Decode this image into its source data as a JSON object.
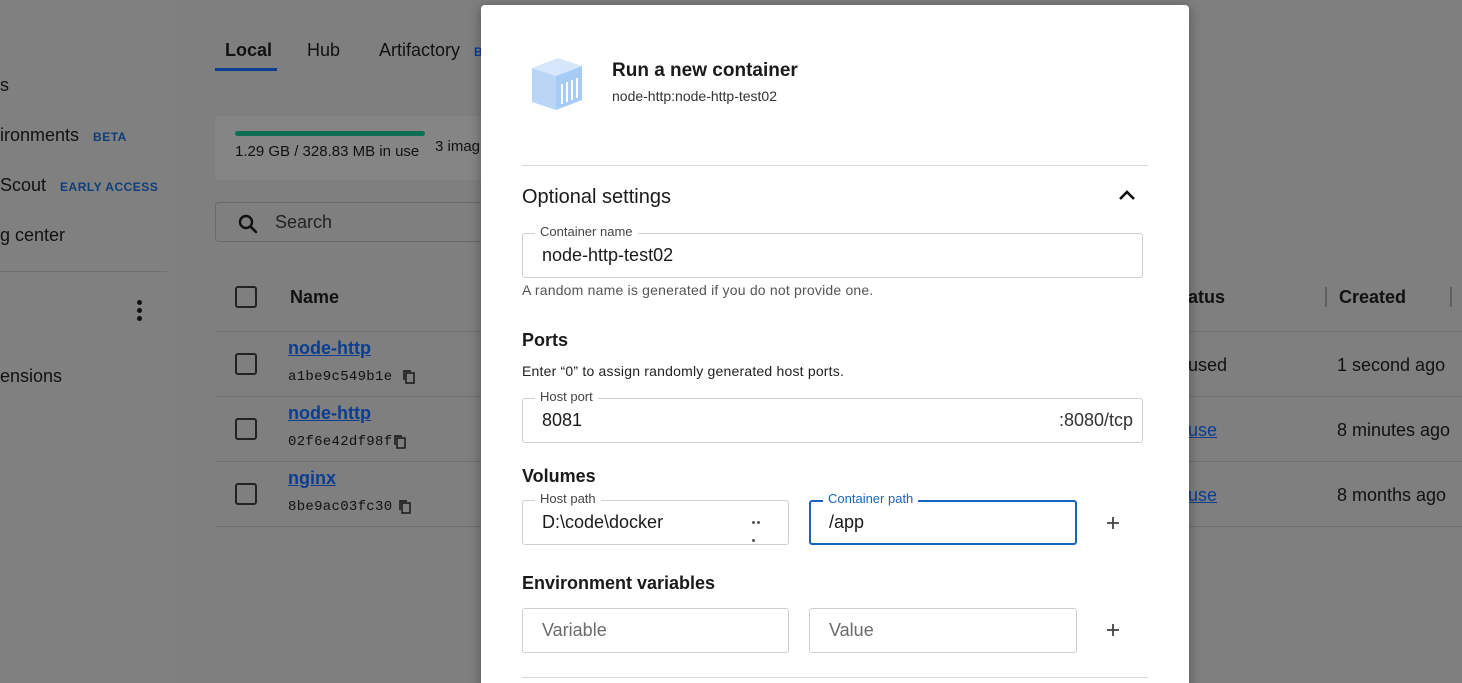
{
  "sidebar": {
    "items": [
      {
        "label": "s",
        "badge": ""
      },
      {
        "label": "ironments",
        "badge": "BETA"
      },
      {
        "label": "Scout",
        "badge": "EARLY ACCESS"
      },
      {
        "label": "g center",
        "badge": ""
      },
      {
        "label": "ensions",
        "badge": ""
      }
    ]
  },
  "tabs": [
    "Local",
    "Hub",
    "Artifactory"
  ],
  "tab_badge_partial": "B",
  "usage": {
    "text": "1.29 GB / 328.83 MB in use",
    "images_count_text": "3 imag",
    "fill_fraction": 1.0
  },
  "search": {
    "placeholder": "Search"
  },
  "table": {
    "headers": {
      "name": "Name",
      "status": "atus",
      "created": "Created"
    },
    "rows": [
      {
        "name": "node-http",
        "id": "a1be9c549b1e",
        "status": "used",
        "status_link": false,
        "created": "1 second ago"
      },
      {
        "name": "node-http",
        "id": "02f6e42df98f",
        "status": "use",
        "status_link": true,
        "created": "8 minutes ago"
      },
      {
        "name": "nginx",
        "id": "8be9ac03fc30",
        "status": "use",
        "status_link": true,
        "created": "8 months ago"
      }
    ]
  },
  "modal": {
    "title": "Run a new container",
    "subtitle": "node-http:node-http-test02",
    "optional_settings": "Optional settings",
    "container_name": {
      "label": "Container name",
      "value": "node-http-test02",
      "helper": "A random name is generated if you do not provide one."
    },
    "ports": {
      "title": "Ports",
      "description": "Enter “0” to assign randomly generated host ports.",
      "host_port_label": "Host port",
      "host_port_value": "8081",
      "container_port": ":8080/tcp"
    },
    "volumes": {
      "title": "Volumes",
      "host_path_label": "Host path",
      "host_path_value": "D:\\code\\docker",
      "container_path_label": "Container path",
      "container_path_value": "/app"
    },
    "env": {
      "title": "Environment variables",
      "variable_placeholder": "Variable",
      "value_placeholder": "Value"
    }
  },
  "colors": {
    "accent": "#1565c0",
    "link": "#0b3d91",
    "usage_bar": "#0e6e53",
    "overlay": "#7f7f7f"
  }
}
